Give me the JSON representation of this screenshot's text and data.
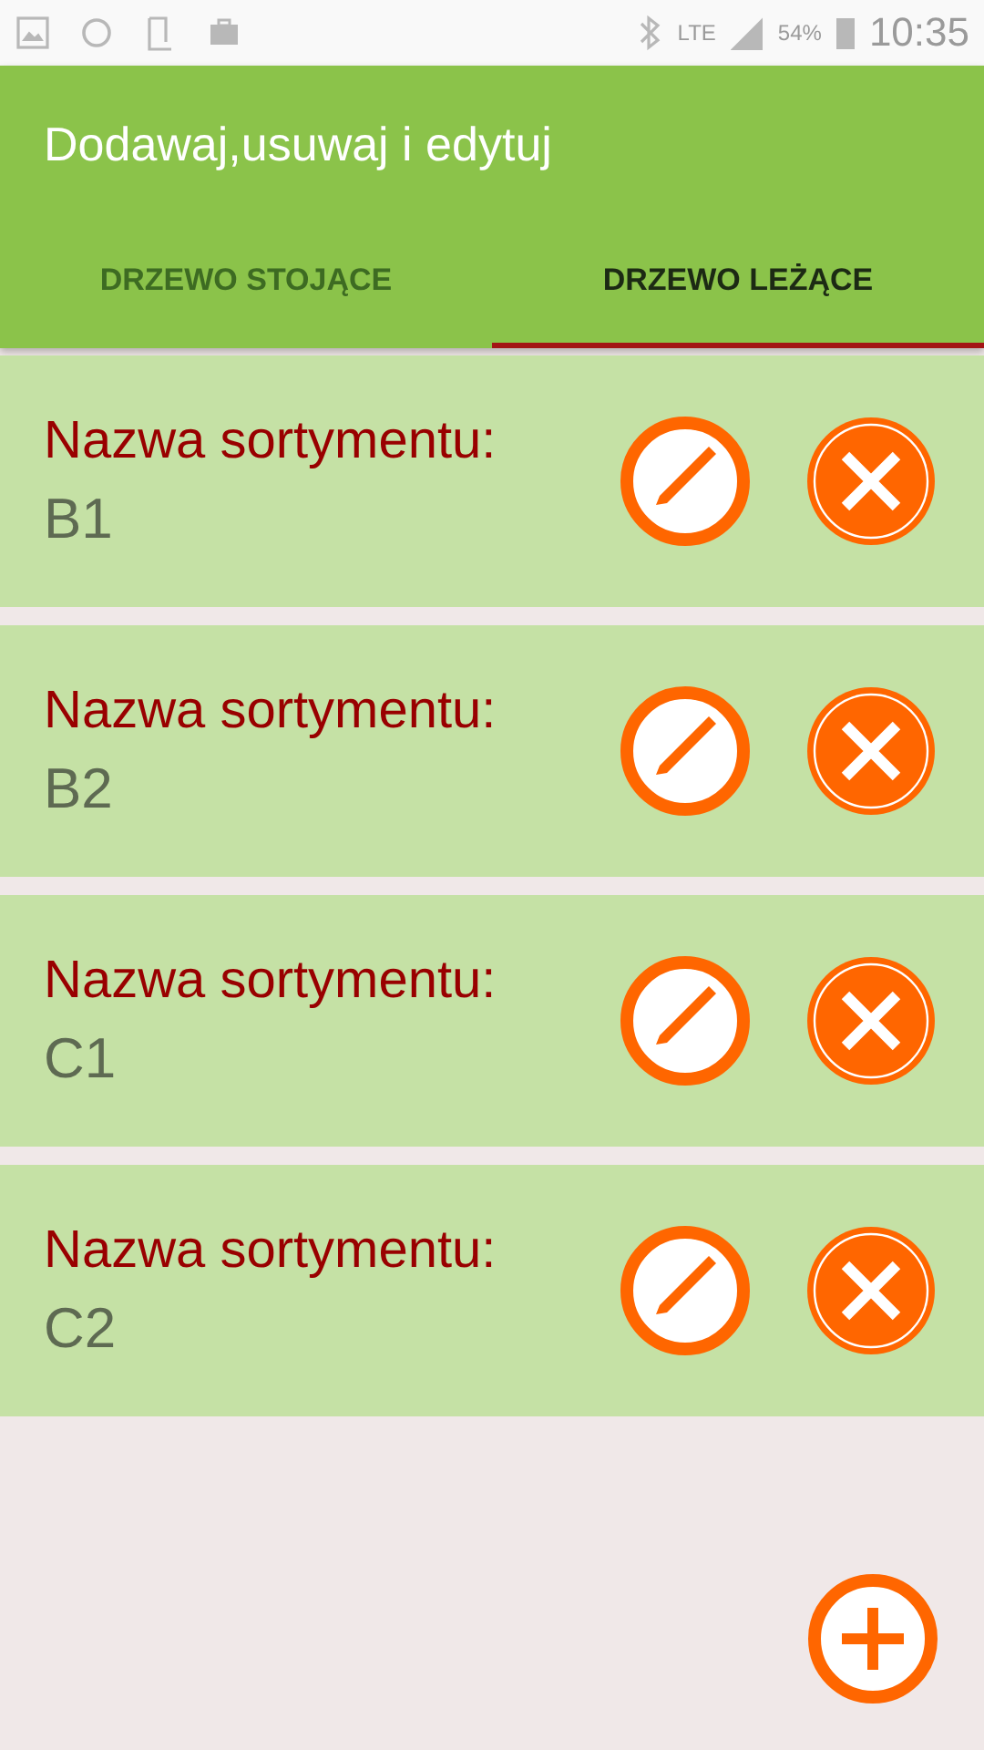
{
  "status_bar": {
    "network": "LTE",
    "battery": "54%",
    "time": "10:35"
  },
  "app_bar": {
    "title": "Dodawaj,usuwaj i edytuj"
  },
  "tabs": [
    {
      "label": "DRZEWO STOJĄCE",
      "selected": false
    },
    {
      "label": "DRZEWO LEŻĄCE",
      "selected": true
    }
  ],
  "items": [
    {
      "label": "Nazwa sortymentu:",
      "value": "B1"
    },
    {
      "label": "Nazwa sortymentu:",
      "value": "B2"
    },
    {
      "label": "Nazwa sortymentu:",
      "value": "C1"
    },
    {
      "label": "Nazwa sortymentu:",
      "value": "C2"
    }
  ]
}
